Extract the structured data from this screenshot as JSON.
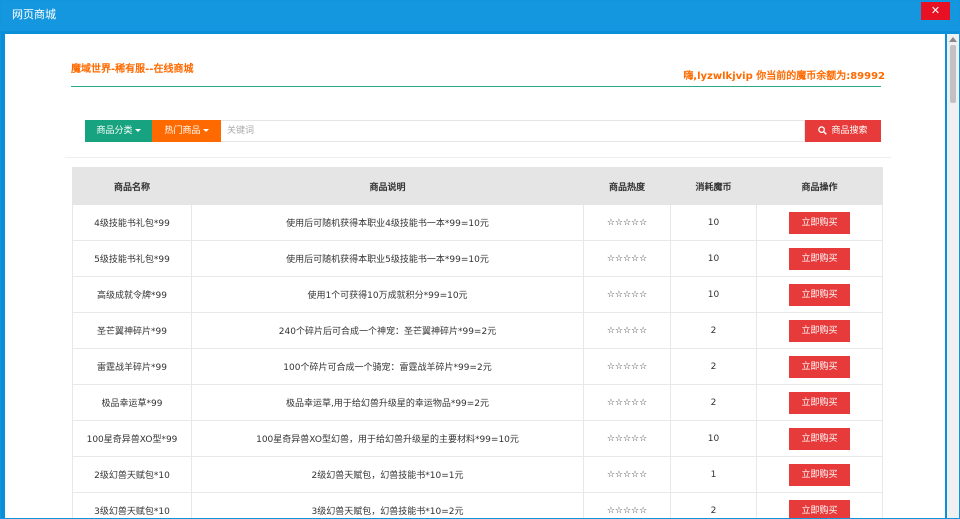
{
  "window": {
    "title": "网页商城",
    "close_label": "✕"
  },
  "header": {
    "left": "魔域世界-稀有服--在线商城",
    "right": "嗨,lyzwlkjvip 你当前的魔币余额为:89992"
  },
  "search": {
    "category_label": "商品分类",
    "hot_label": "热门商品",
    "placeholder": "关键词",
    "button_label": "商品搜索"
  },
  "table": {
    "headers": [
      "商品名称",
      "商品说明",
      "商品热度",
      "消耗魔币",
      "商品操作"
    ],
    "buy_label": "立即购买",
    "rows": [
      {
        "name": "4级技能书礼包*99",
        "desc": "使用后可随机获得本职业4级技能书一本*99=10元",
        "heat": "☆☆☆☆☆",
        "cost": "10"
      },
      {
        "name": "5级技能书礼包*99",
        "desc": "使用后可随机获得本职业5级技能书一本*99=10元",
        "heat": "☆☆☆☆☆",
        "cost": "10"
      },
      {
        "name": "高级成就令牌*99",
        "desc": "使用1个可获得10万成就积分*99=10元",
        "heat": "☆☆☆☆☆",
        "cost": "10"
      },
      {
        "name": "圣芒翼神碎片*99",
        "desc": "240个碎片后可合成一个神宠：圣芒翼神碎片*99=2元",
        "heat": "☆☆☆☆☆",
        "cost": "2"
      },
      {
        "name": "雷霆战羊碎片*99",
        "desc": "100个碎片可合成一个骑宠：雷霆战羊碎片*99=2元",
        "heat": "☆☆☆☆☆",
        "cost": "2"
      },
      {
        "name": "极品幸运草*99",
        "desc": "极品幸运草,用于给幻兽升级星的幸运物品*99=2元",
        "heat": "☆☆☆☆☆",
        "cost": "2"
      },
      {
        "name": "100星奇异兽XO型*99",
        "desc": "100星奇异兽XO型幻兽，用于给幻兽升级星的主要材料*99=10元",
        "heat": "☆☆☆☆☆",
        "cost": "10"
      },
      {
        "name": "2级幻兽天赋包*10",
        "desc": "2级幻兽天赋包，幻兽技能书*10=1元",
        "heat": "☆☆☆☆☆",
        "cost": "1"
      },
      {
        "name": "3级幻兽天赋包*10",
        "desc": "3级幻兽天赋包，幻兽技能书*10=2元",
        "heat": "☆☆☆☆☆",
        "cost": "2"
      }
    ]
  }
}
